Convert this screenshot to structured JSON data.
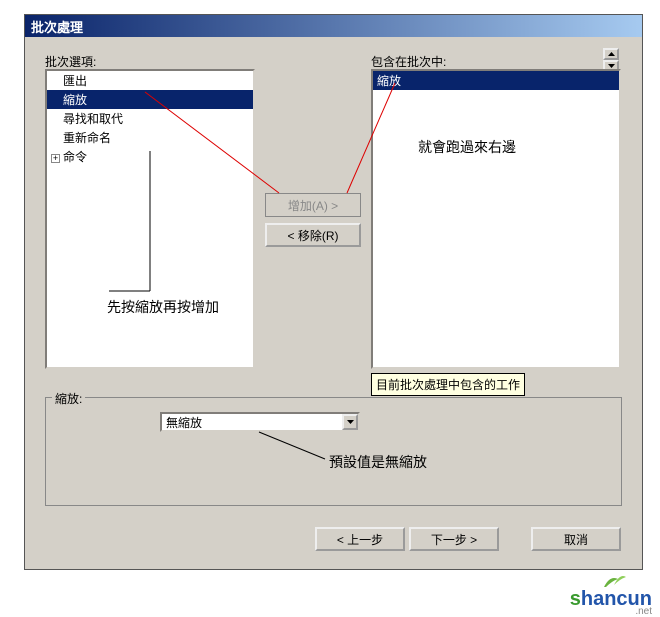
{
  "titlebar": {
    "title": "批次處理"
  },
  "labels": {
    "options": "批次選項:",
    "included": "包含在批次中:"
  },
  "options_list": {
    "items": [
      {
        "text": "匯出",
        "indent": 1,
        "selected": false
      },
      {
        "text": "縮放",
        "indent": 1,
        "selected": true
      },
      {
        "text": "尋找和取代",
        "indent": 1,
        "selected": false
      },
      {
        "text": "重新命名",
        "indent": 1,
        "selected": false
      }
    ],
    "expandable": {
      "symbol": "+",
      "text": "命令"
    }
  },
  "included_list": {
    "items": [
      {
        "text": "縮放",
        "selected": true
      }
    ]
  },
  "buttons": {
    "add": "增加(A) >",
    "remove": "< 移除(R)",
    "back": "< 上一步",
    "next": "下一步 >",
    "cancel": "取消"
  },
  "tooltip": {
    "text": "目前批次處理中包含的工作"
  },
  "groupbox": {
    "label": "縮放:",
    "combo": {
      "value": "無縮放"
    }
  },
  "annotations": {
    "left": "先按縮放再按增加",
    "right": "就會跑過來右邊",
    "bottom": "預設值是無縮放"
  },
  "watermark": {
    "s": "s",
    "rest": "hancun",
    "sub": ".net"
  }
}
